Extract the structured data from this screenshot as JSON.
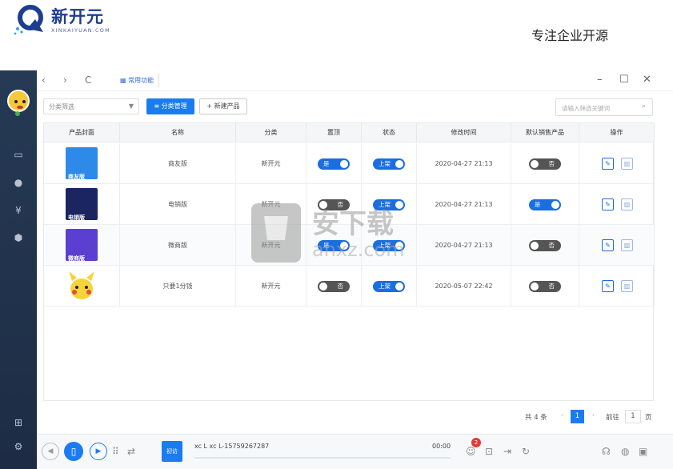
{
  "banner": {
    "logo_cn": "新开元",
    "logo_en": "XINKAIYUAN.COM",
    "slogan": "专注企业开源"
  },
  "toolbar": {
    "back": "‹",
    "forward": "›",
    "refresh": "C",
    "tab_label": "常用功能",
    "min": "–",
    "max": "☐",
    "close": "✕"
  },
  "actions": {
    "filter_placeholder": "分类筛选",
    "category_btn": "≡ 分类管理",
    "new_btn": "+ 新建产品",
    "search_placeholder": "请输入筛选关键词"
  },
  "columns": [
    "产品封面",
    "名称",
    "分类",
    "置顶",
    "状态",
    "修改时间",
    "默认销售产品",
    "操作"
  ],
  "rows": [
    {
      "cover_text": "商友版",
      "cover_color": "#2e8ae8",
      "name": "商友版",
      "category": "新开元",
      "top": "是",
      "top_on": true,
      "status": "上架",
      "status_on": true,
      "time": "2020-04-27 21:13",
      "default": "否",
      "default_on": false
    },
    {
      "cover_text": "电销版",
      "cover_color": "#1b2560",
      "name": "电销版",
      "category": "新开元",
      "top": "否",
      "top_on": false,
      "status": "上架",
      "status_on": true,
      "time": "2020-04-27 21:13",
      "default": "是",
      "default_on": true
    },
    {
      "cover_text": "微商版",
      "cover_color": "#5a3fd0",
      "name": "微商版",
      "category": "新开元",
      "top": "是",
      "top_on": true,
      "status": "上架",
      "status_on": true,
      "time": "2020-04-27 21:13",
      "default": "否",
      "default_on": false
    },
    {
      "cover_text": "",
      "cover_color": "#ffffff",
      "name": "只要1分钱",
      "category": "新开元",
      "top": "否",
      "top_on": false,
      "status": "上架",
      "status_on": true,
      "time": "2020-05-07 22:42",
      "default": "否",
      "default_on": false
    }
  ],
  "pager": {
    "total": "共 4 条",
    "prev": "‹",
    "page": "1",
    "next": "›",
    "goto_label": "前往",
    "goto_value": "1",
    "page_unit": "页"
  },
  "player": {
    "tag": "初访",
    "caller": "xc L  xc L-15759267287",
    "time": "00:00",
    "badge": "2"
  },
  "watermark": {
    "cn": "安下载",
    "en": "anxz.com"
  },
  "colors": {
    "accent": "#1a7cf0",
    "sidebar": "#1f2e46"
  }
}
